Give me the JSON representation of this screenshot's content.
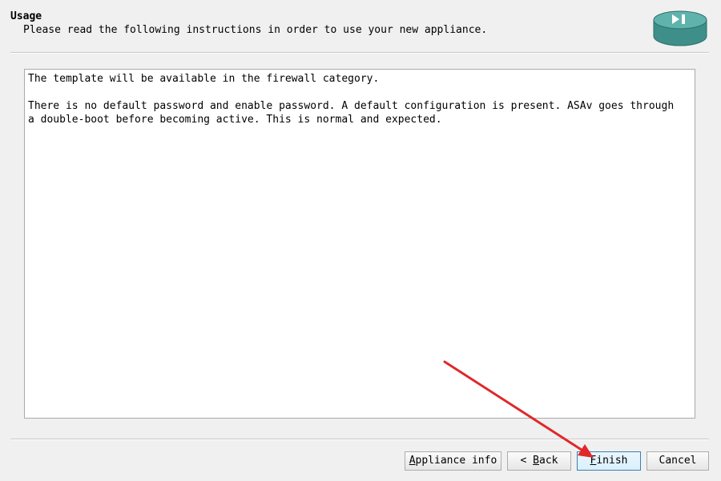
{
  "header": {
    "title": "Usage",
    "subtitle": "Please read the following instructions in order to use your new appliance.",
    "logo_icon": "router-forward-icon"
  },
  "content": {
    "paragraphs": [
      "The template will be available in the firewall category.",
      "There is no default password and enable password. A default configuration is present. ASAv goes through\na double-boot before becoming active. This is normal and expected."
    ]
  },
  "buttons": {
    "appliance_info": {
      "mnemonic": "A",
      "rest": "ppliance info"
    },
    "back": {
      "prefix": "< ",
      "mnemonic": "B",
      "rest": "ack"
    },
    "finish": {
      "mnemonic": "F",
      "rest": "inish"
    },
    "cancel": {
      "label": "Cancel"
    }
  },
  "annotation": {
    "arrow_color": "#e0282a"
  },
  "colors": {
    "logo_body": "#3e8f8a",
    "logo_top": "#5fb3ad"
  }
}
